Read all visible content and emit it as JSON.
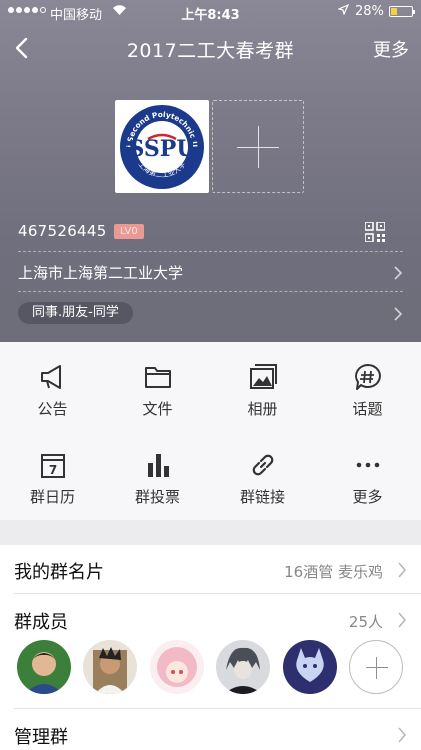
{
  "status_bar": {
    "carrier": "中国移动",
    "time": "上午8:43",
    "battery": "28%",
    "battery_level": 0.28
  },
  "nav": {
    "title": "2017二工大春考群",
    "more": "更多"
  },
  "group": {
    "id": "467526445",
    "level": "LV0",
    "location": "上海市上海第二工业大学",
    "tag": "同事.朋友-同学"
  },
  "logo": {
    "ring_text": "Shanghai Second Polytechnic University",
    "bottom_text": "上海第二工业大学",
    "letters": "SSPU"
  },
  "functions": [
    {
      "label": "公告",
      "icon": "megaphone-icon"
    },
    {
      "label": "文件",
      "icon": "folder-icon"
    },
    {
      "label": "相册",
      "icon": "photo-album-icon"
    },
    {
      "label": "话题",
      "icon": "topic-hash-icon"
    },
    {
      "label": "群日历",
      "icon": "calendar-icon"
    },
    {
      "label": "群投票",
      "icon": "bar-chart-icon"
    },
    {
      "label": "群链接",
      "icon": "link-icon"
    },
    {
      "label": "更多",
      "icon": "more-dots-icon"
    }
  ],
  "calendar_day": "7",
  "my_card": {
    "title": "我的群名片",
    "value": "16酒管 麦乐鸡"
  },
  "members": {
    "title": "群成员",
    "count": "25人",
    "avatar_colors": [
      "#3c7f3a",
      "#9a7f5c",
      "#f2b9c6",
      "#4b4e56",
      "#2d2f6e"
    ]
  },
  "manage": {
    "title": "管理群"
  },
  "colors": {
    "header_bg": "#7c7a88",
    "badge": "#e89a93",
    "logo_blue": "#1b3a8c",
    "logo_red": "#d0262d"
  }
}
